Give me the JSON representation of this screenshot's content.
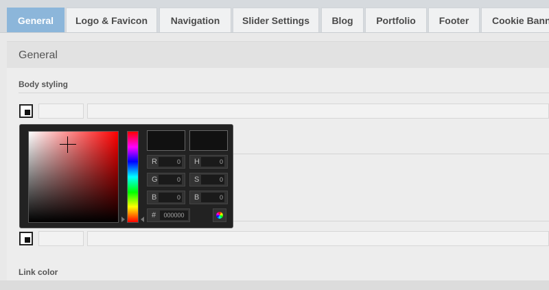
{
  "tabs": [
    {
      "label": "General",
      "active": true
    },
    {
      "label": "Logo & Favicon",
      "active": false
    },
    {
      "label": "Navigation",
      "active": false
    },
    {
      "label": "Slider Settings",
      "active": false
    },
    {
      "label": "Blog",
      "active": false
    },
    {
      "label": "Portfolio",
      "active": false
    },
    {
      "label": "Footer",
      "active": false
    },
    {
      "label": "Cookie Bann",
      "active": false
    }
  ],
  "section": {
    "title": "General"
  },
  "fields": {
    "body_styling_label": "Body styling",
    "link_color_label": "Link color"
  },
  "picker": {
    "r_label": "R",
    "r_value": "0",
    "g_label": "G",
    "g_value": "0",
    "b_label": "B",
    "b_value": "0",
    "h_label": "H",
    "h_value": "0",
    "s_label": "S",
    "s_value": "0",
    "v_label": "B",
    "v_value": "0",
    "hex_label": "#",
    "hex_value": "000000",
    "current_color": "#111111",
    "hue_color": "#ff0000"
  },
  "colors": {
    "active_tab": "#8cb6da",
    "tab_bar": "#d6dade"
  }
}
